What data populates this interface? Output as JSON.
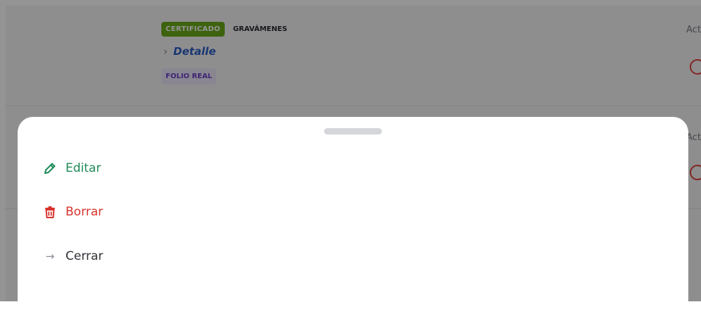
{
  "background": {
    "row1": {
      "badge_certificado": "CERTIFICADO",
      "badge_gravamenes": "GRAVÁMENES",
      "detalle_label": "Detalle",
      "badge_folio": "FOLIO REAL",
      "acciones_label": "Act"
    },
    "row2": {
      "acciones_label": "Act"
    }
  },
  "sheet": {
    "actions": [
      {
        "label": "Editar",
        "icon": "pencil-icon",
        "color": "#1e8a56"
      },
      {
        "label": "Borrar",
        "icon": "trash-icon",
        "color": "#d8332d"
      },
      {
        "label": "Cerrar",
        "icon": "arrow-right-icon",
        "color": "#2f2f37"
      }
    ]
  }
}
